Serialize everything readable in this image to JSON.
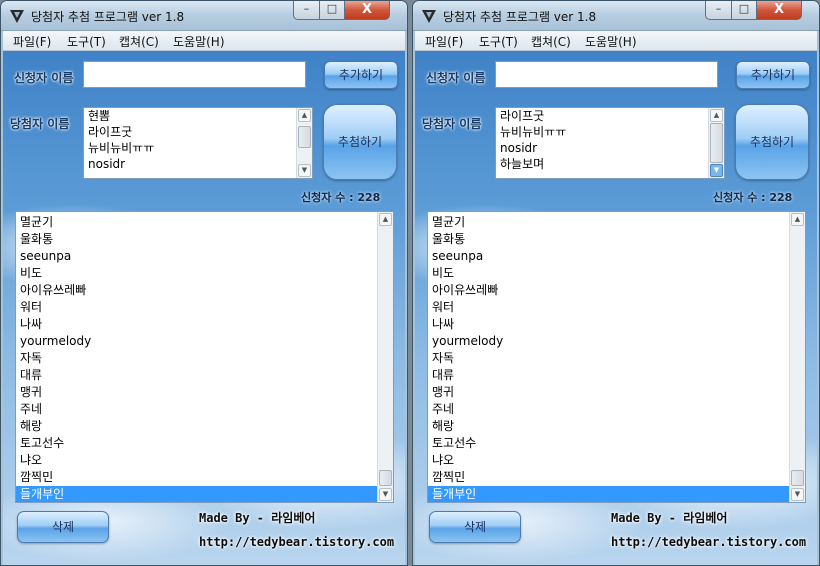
{
  "windows": [
    {
      "title": "당첨자 추첨 프로그램 ver 1.8",
      "title_buttons": {
        "minimize": "–",
        "maximize": "□",
        "close": "X"
      },
      "menu": [
        "파일(F)",
        "도구(T)",
        "캡쳐(C)",
        "도움말(H)"
      ],
      "applicant_label": "신청자 이름",
      "applicant_value": "",
      "add_button": "추가하기",
      "winner_label": "당첨자 이름",
      "winners": [
        "현뽐",
        "라이프굿",
        "뉴비뉴비ㅠㅠ",
        "nosidr"
      ],
      "draw_button": "추첨하기",
      "count_label": "신청자 수 : 228",
      "list": [
        "멸균기",
        "울화통",
        "seeunpa",
        "비도",
        "아이유쓰레빠",
        "워터",
        "나싸",
        "yourmelody",
        "자독",
        "대류",
        "맹귀",
        "주네",
        "해랑",
        "토고선수",
        "냐오",
        "깜찍민",
        "들개부인"
      ],
      "selected": "들개부인",
      "delete_button": "삭제",
      "made_by": "Made By - 라임베어",
      "url": "http://tedybear.tistory.com"
    },
    {
      "title": "당첨자 추첨 프로그램 ver 1.8",
      "title_buttons": {
        "minimize": "–",
        "maximize": "□",
        "close": "X"
      },
      "menu": [
        "파일(F)",
        "도구(T)",
        "캡쳐(C)",
        "도움말(H)"
      ],
      "applicant_label": "신청자 이름",
      "applicant_value": "",
      "add_button": "추가하기",
      "winner_label": "당첨자 이름",
      "winners": [
        "라이프굿",
        "뉴비뉴비ㅠㅠ",
        "nosidr",
        "하늘보며"
      ],
      "draw_button": "추첨하기",
      "count_label": "신청자 수 : 228",
      "list": [
        "멸균기",
        "울화통",
        "seeunpa",
        "비도",
        "아이유쓰레빠",
        "워터",
        "나싸",
        "yourmelody",
        "자독",
        "대류",
        "맹귀",
        "주네",
        "해랑",
        "토고선수",
        "냐오",
        "깜찍민",
        "들개부인"
      ],
      "selected": "들개부인",
      "delete_button": "삭제",
      "made_by": "Made By - 라임베어",
      "url": "http://tedybear.tistory.com"
    }
  ]
}
